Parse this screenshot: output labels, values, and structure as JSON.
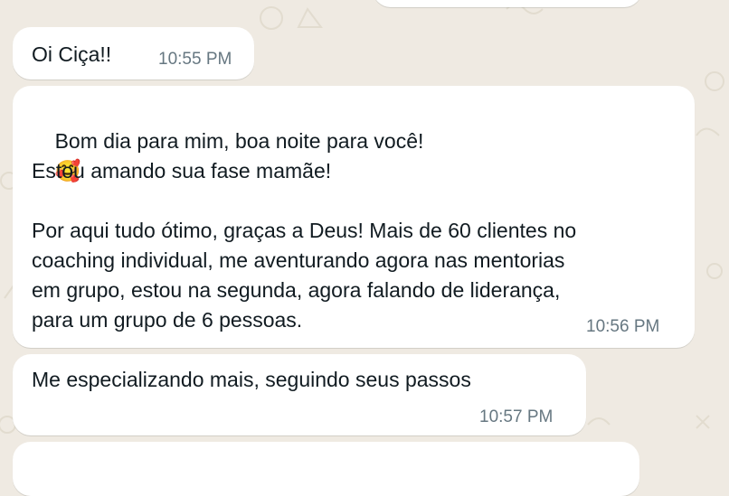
{
  "chat": {
    "messages": [
      {
        "text": "Oi Ciça!!",
        "time": "10:55 PM"
      },
      {
        "line1": "Bom dia para mim, boa noite para você!",
        "emoji": "🥰",
        "line2": "Estou amando sua fase mamãe!",
        "line3": "Por aqui tudo ótimo, graças a Deus! Mais de 60 clientes no\ncoaching individual, me aventurando agora nas mentorias\nem grupo, estou na segunda, agora falando de liderança,\npara um grupo de 6 pessoas.",
        "time": "10:56 PM"
      },
      {
        "text": "Me especializando mais, seguindo seus passos",
        "time": "10:57 PM"
      }
    ]
  },
  "colors": {
    "background": "#efeae2",
    "bubble": "#ffffff",
    "timestamp": "#667781",
    "text": "#111b21"
  }
}
